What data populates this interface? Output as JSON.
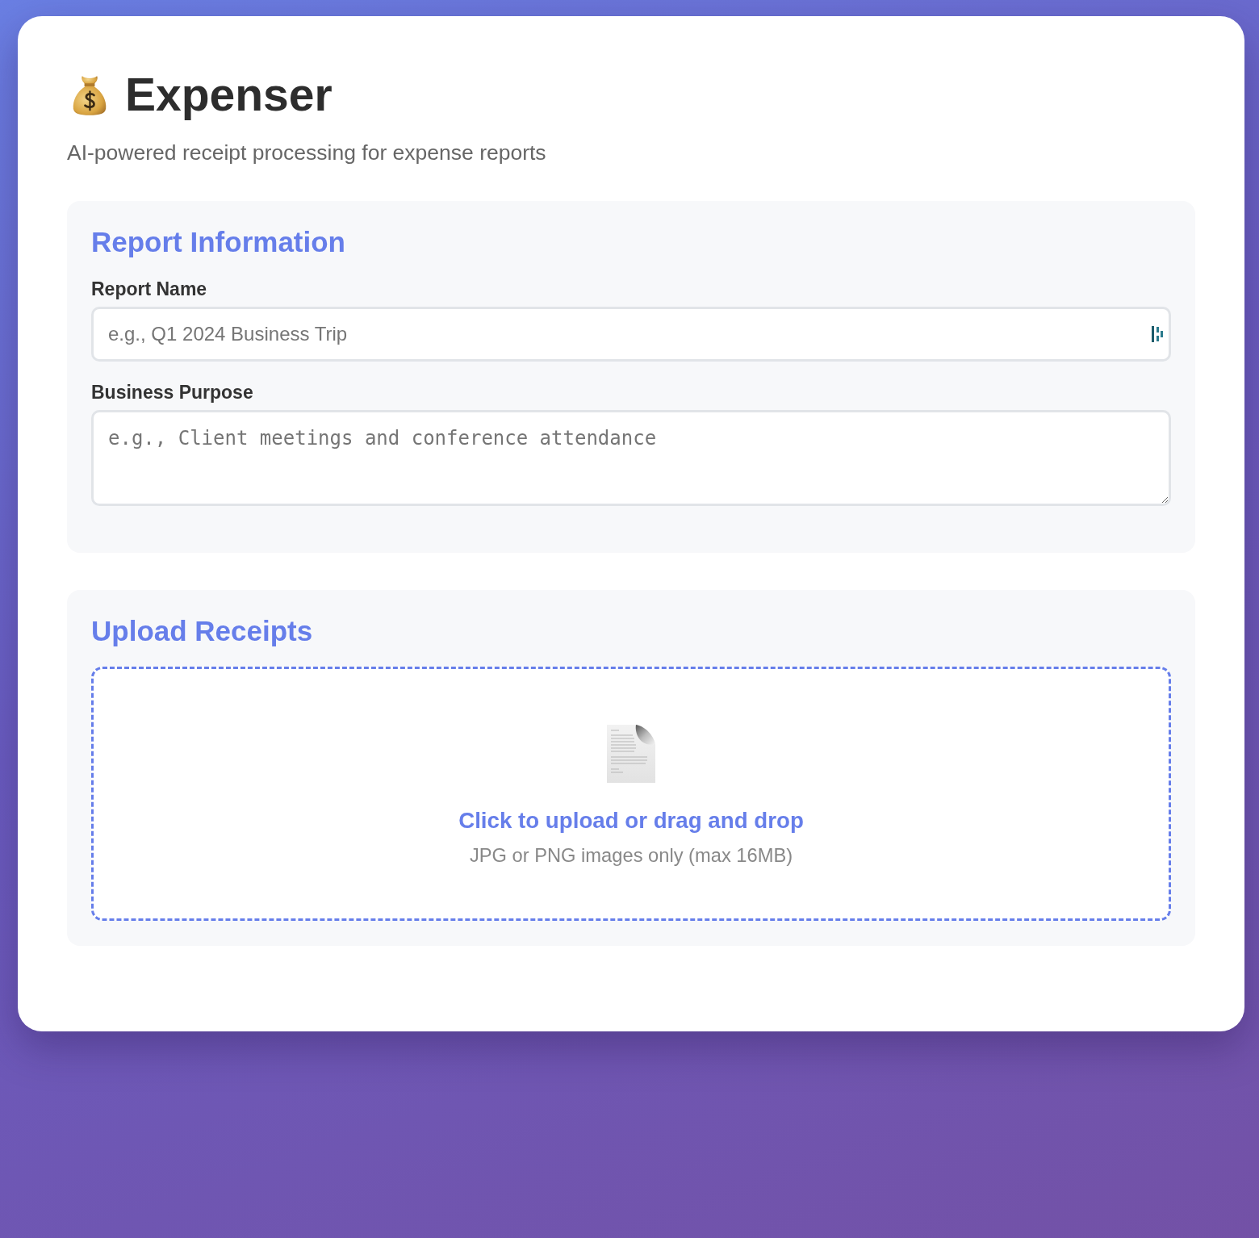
{
  "header": {
    "title": "Expenser",
    "subtitle": "AI-powered receipt processing for expense reports"
  },
  "report_information": {
    "heading": "Report Information",
    "fields": [
      {
        "kind": "input",
        "label": "Report Name",
        "placeholder": "e.g., Q1 2024 Business Trip"
      },
      {
        "kind": "textarea",
        "label": "Business Purpose",
        "placeholder": "e.g., Client meetings and conference attendance"
      }
    ]
  },
  "upload_receipts": {
    "heading": "Upload Receipts",
    "dropzone": {
      "prompt": "Click to upload or drag and drop",
      "hint": "JPG or PNG images only (max 16MB)"
    }
  }
}
